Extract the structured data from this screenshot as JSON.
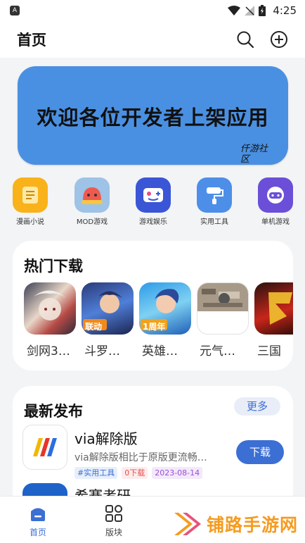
{
  "status_bar": {
    "time": "4:25"
  },
  "header": {
    "title": "首页",
    "icons": [
      "search-icon",
      "add-circle-icon"
    ]
  },
  "banner": {
    "text": "欢迎各位开发者上架应用",
    "signature": "仟游社区"
  },
  "categories": [
    {
      "label": "漫画小说",
      "icon": "comic-icon",
      "color": "#f9b21a"
    },
    {
      "label": "MOD游戏",
      "icon": "mod-game-icon",
      "color": "#9ec3e6"
    },
    {
      "label": "游戏娱乐",
      "icon": "gamepad-icon",
      "color": "#3a56d6"
    },
    {
      "label": "实用工具",
      "icon": "paint-roller-icon",
      "color": "#4d8fe8"
    },
    {
      "label": "单机游戏",
      "icon": "controller-icon",
      "color": "#6b4fd8"
    }
  ],
  "hot": {
    "title": "热门下载",
    "items": [
      {
        "name": "剑网3…",
        "badge": ""
      },
      {
        "name": "斗罗…",
        "badge": "联动"
      },
      {
        "name": "英雄…",
        "badge": "1周年"
      },
      {
        "name": "元气…",
        "badge": ""
      },
      {
        "name": "三国",
        "badge": ""
      }
    ]
  },
  "latest": {
    "title": "最新发布",
    "more_label": "更多",
    "apps": [
      {
        "name": "via解除版",
        "desc": "via解除版相比于原版更流畅…",
        "tags": [
          "#实用工具",
          "0下载",
          "2023-08-14"
        ],
        "action": "下载"
      },
      {
        "name": "希赛考研"
      }
    ]
  },
  "bottom_nav": [
    {
      "label": "首页",
      "icon": "home-icon",
      "active": true
    },
    {
      "label": "版块",
      "icon": "grid-icon",
      "active": false
    }
  ],
  "watermark": {
    "text": "铺路手游网"
  },
  "colors": {
    "accent": "#3b6fd4",
    "banner_bg": "#4a90e2",
    "page_bg": "#f3f4f6"
  }
}
